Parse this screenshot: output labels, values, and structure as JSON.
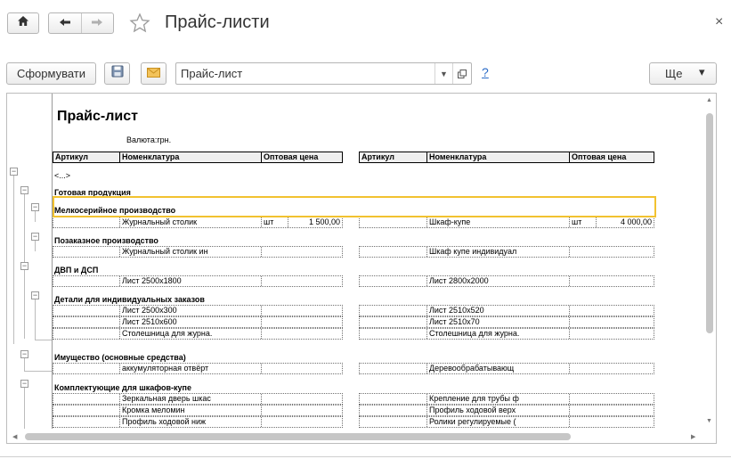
{
  "window": {
    "title": "Прайс-листи",
    "close_symbol": "×"
  },
  "toolbar": {
    "form_button": "Сформувати",
    "report_select_value": "Прайс-лист",
    "help": "?",
    "more_button": "Ще",
    "more_arrow": "▾"
  },
  "icons": {
    "home": "home-icon",
    "back": "arrow-left-icon",
    "forward": "arrow-right-icon",
    "favorite": "star-icon",
    "save": "floppy-disk-icon",
    "email": "envelope-icon",
    "open": "open-window-icon",
    "close": "close-icon"
  },
  "colors": {
    "selection": "#f2c230",
    "link": "#2a6bc7"
  },
  "report": {
    "title": "Прайс-лист",
    "currency": "Валюта:грн.",
    "left_headers": [
      "Артикул",
      "Номенклатура",
      "Оптовая цена"
    ],
    "right_headers": [
      "Артикул",
      "Номенклатура",
      "Оптовая цена"
    ],
    "ellipsis": "<...>",
    "groups": {
      "finished": "Готовая продукция",
      "small_batch": "Мелкосерийное производство",
      "custom": "Позаказное производство",
      "dvp": "ДВП и ДСП",
      "parts": "Детали для индивидуальных заказов",
      "assets": "Имущество (основные средства)",
      "kits": "Комплектующие для шкафов-купе"
    },
    "rows": {
      "r1": {
        "left_item": "Журнальный столик",
        "left_unit": "шт",
        "left_price": "1 500,00",
        "right_item": "Шкаф-купе",
        "right_unit": "шт",
        "right_price": "4 000,00"
      },
      "r2": {
        "left_item": "Журнальный столик ин",
        "right_item": "Шкаф купе индивидуал"
      },
      "r3": {
        "left_item": "Лист 2500х1800",
        "right_item": "Лист 2800х2000"
      },
      "r4": {
        "left_item": "Лист 2500х300",
        "right_item": "Лист 2510х520"
      },
      "r5": {
        "left_item": "Лист 2510х600",
        "right_item": "Лист 2510х70"
      },
      "r6": {
        "left_item": "Столешница для журна.",
        "right_item": "Столешница для журна."
      },
      "r7": {
        "left_item": "аккумуляторная отвёрт",
        "right_item": "Деревообрабатывающ"
      },
      "r8": {
        "left_item": "Зеркальная дверь шкас",
        "right_item": "Крепление для трубы ф"
      },
      "r9": {
        "left_item": "Кромка меломин",
        "right_item": "Профиль ходовой верх"
      },
      "r10": {
        "left_item": "Профиль ходовой ниж",
        "right_item": "Ролики регулируемые ("
      }
    },
    "tree_minus": "−"
  }
}
